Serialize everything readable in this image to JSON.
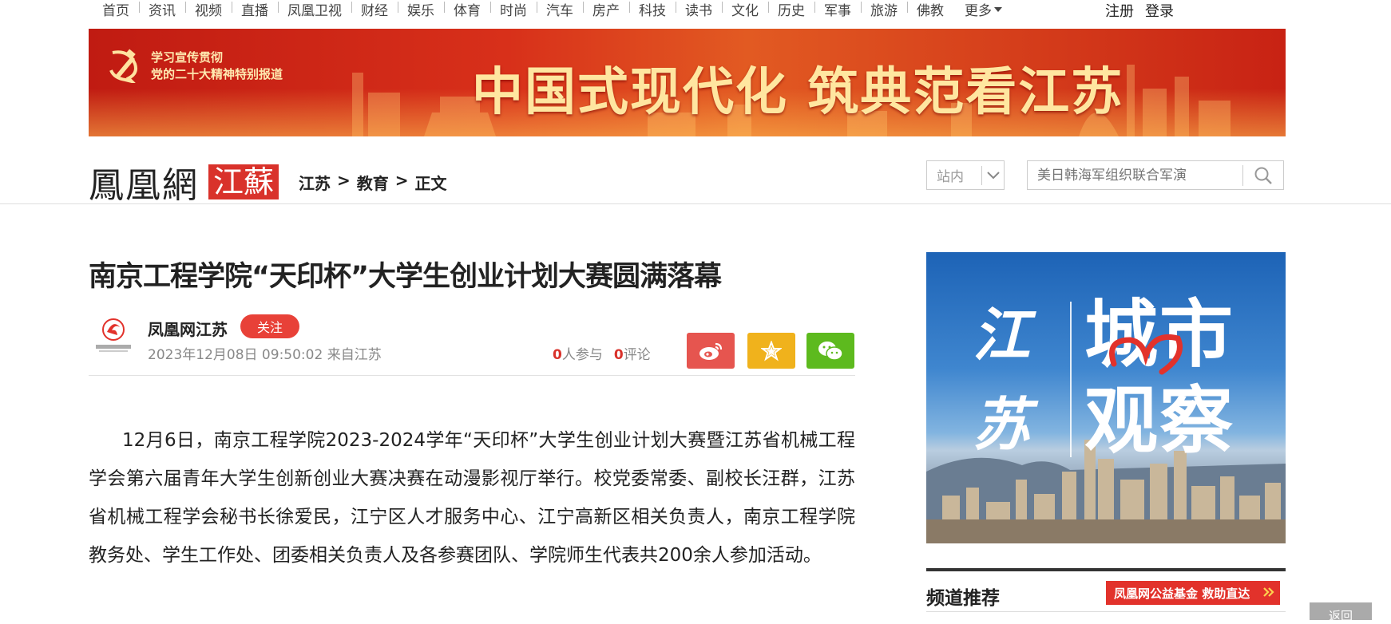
{
  "nav": {
    "items": [
      "首页",
      "资讯",
      "视频",
      "直播",
      "凤凰卫视",
      "财经",
      "娱乐",
      "体育",
      "时尚",
      "汽车",
      "房产",
      "科技",
      "读书",
      "文化",
      "历史",
      "军事",
      "旅游",
      "佛教"
    ],
    "more": "更多"
  },
  "auth": {
    "register": "注册",
    "login": "登录"
  },
  "banner": {
    "subtitle_line1": "学习宣传贯彻",
    "subtitle_line2": "党的二十大精神特别报道",
    "headline": "中国式现代化 筑典范看江苏"
  },
  "brand": {
    "logo": "鳳凰網",
    "region": "江蘇"
  },
  "breadcrumb": {
    "level1": "江苏",
    "level2": "教育",
    "level3": "正文",
    "sep": ">"
  },
  "site_select": {
    "label": "站内"
  },
  "search": {
    "placeholder": "美日韩海军组织联合军演"
  },
  "article": {
    "title": "南京工程学院“天印杯”大学生创业计划大赛圆满落幕",
    "author": "凤凰网江苏",
    "follow": "关注",
    "date": "2023年12月08日 09:50:02",
    "source": "来自江苏",
    "participants_count": "0",
    "participants_label": "人参与",
    "comments_count": "0",
    "comments_label": "评论",
    "body": "12月6日，南京工程学院2023-2024学年“天印杯”大学生创业计划大赛暨江苏省机械工程学会第六届青年大学生创新创业大赛决赛在动漫影视厅举行。校党委常委、副校长汪群，江苏省机械工程学会秘书长徐爱民，江宁区人才服务中心、江宁高新区相关负责人，南京工程学院教务处、学生工作处、团委相关负责人及各参赛团队、学院师生代表共200余人参加活动。"
  },
  "promo": {
    "left": "江苏",
    "right": "城市观察"
  },
  "recommend": {
    "title": "频道推荐",
    "tag": "凤凰网公益基金 救助直达"
  },
  "back_button": "返回",
  "colors": {
    "accent_red": "#d9322b",
    "weibo": "#e6554f",
    "favorite": "#f0b21c",
    "wechat": "#5dba1e"
  }
}
